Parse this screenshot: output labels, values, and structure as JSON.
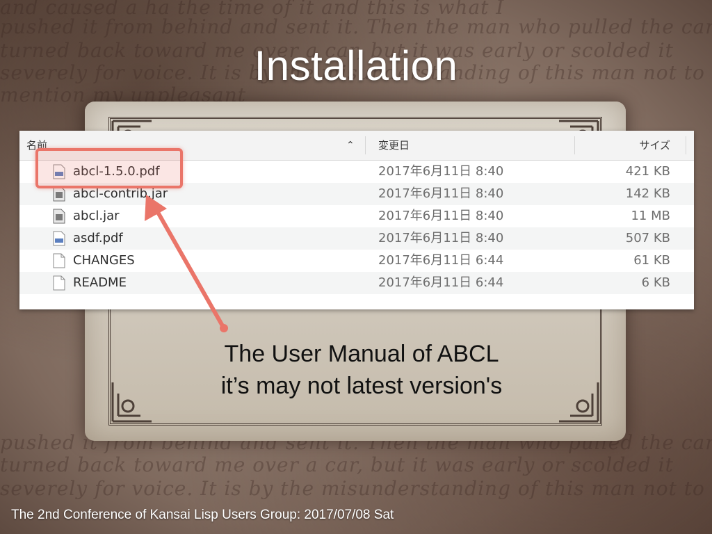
{
  "slide": {
    "title": "Installation",
    "caption_line1": "The User Manual of ABCL",
    "caption_line2": "it’s may not latest version's",
    "footer": "The 2nd Conference of Kansai Lisp Users Group: 2017/07/08 Sat"
  },
  "background_script": [
    "and caused a ha the time of it and this is what I",
    "pushed it from behind and sent it. Then the man who pulled the car",
    "turned back toward me over a car, but it was early or scolded it",
    "severely for voice. It is by the misunderstanding of this man not to",
    "mention my unpleasant"
  ],
  "finder": {
    "columns": {
      "name": "名前",
      "date": "変更日",
      "size": "サイズ"
    },
    "files": [
      {
        "name": "abcl-1.5.0.pdf",
        "date": "2017年6月11日 8:40",
        "size": "421 KB",
        "icon": "pdf-file-icon"
      },
      {
        "name": "abcl-contrib.jar",
        "date": "2017年6月11日 8:40",
        "size": "142 KB",
        "icon": "jar-file-icon"
      },
      {
        "name": "abcl.jar",
        "date": "2017年6月11日 8:40",
        "size": "11 MB",
        "icon": "jar-file-icon"
      },
      {
        "name": "asdf.pdf",
        "date": "2017年6月11日 8:40",
        "size": "507 KB",
        "icon": "pdf-file-icon"
      },
      {
        "name": "CHANGES",
        "date": "2017年6月11日 6:44",
        "size": "61 KB",
        "icon": "document-file-icon"
      },
      {
        "name": "README",
        "date": "2017年6月11日 6:44",
        "size": "6 KB",
        "icon": "document-file-icon"
      }
    ]
  },
  "colors": {
    "highlight": "#ea7569",
    "title": "#ffffff"
  }
}
